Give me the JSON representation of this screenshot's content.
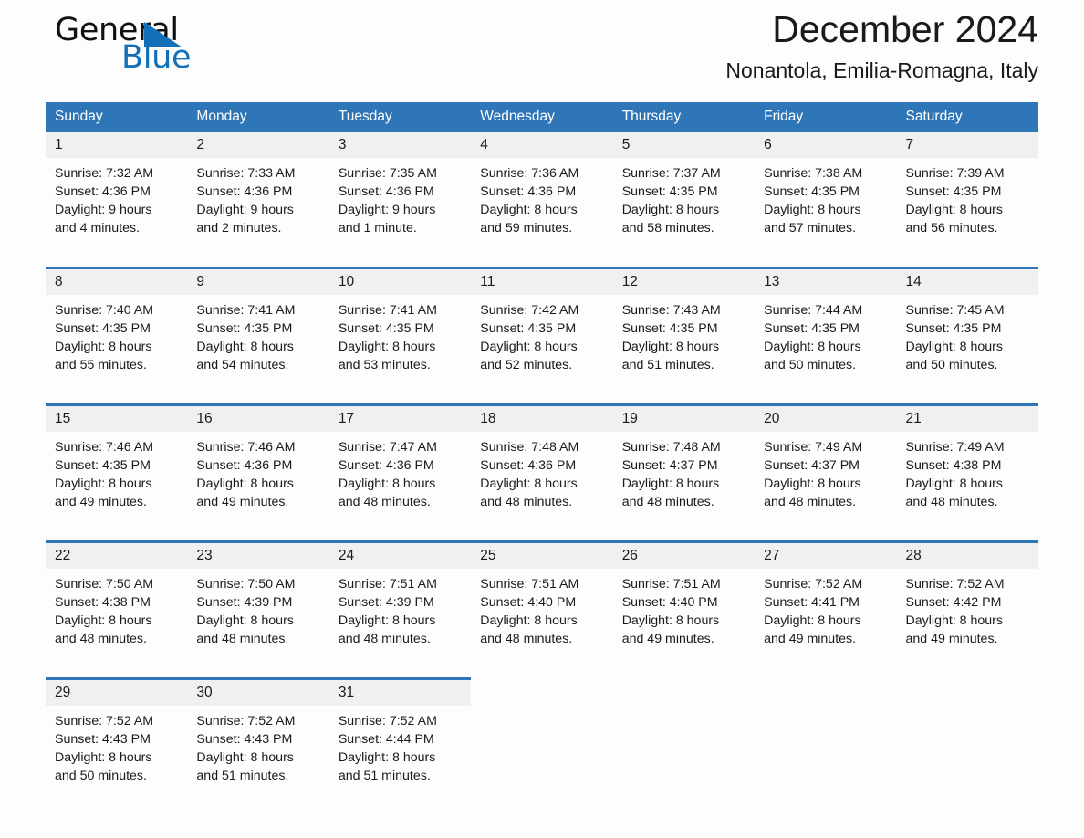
{
  "brand": {
    "word_one": "General",
    "word_two": "Blue",
    "triangle_color": "#1170b8"
  },
  "header": {
    "title": "December 2024",
    "subtitle": "Nonantola, Emilia-Romagna, Italy",
    "header_bg": "#2f76b8",
    "daynum_bg": "#f0f0f0"
  },
  "calendar": {
    "weekday_headers": [
      "Sunday",
      "Monday",
      "Tuesday",
      "Wednesday",
      "Thursday",
      "Friday",
      "Saturday"
    ],
    "weeks": [
      [
        {
          "day": "1",
          "sunrise": "Sunrise: 7:32 AM",
          "sunset": "Sunset: 4:36 PM",
          "daylight_line1": "Daylight: 9 hours",
          "daylight_line2": "and 4 minutes."
        },
        {
          "day": "2",
          "sunrise": "Sunrise: 7:33 AM",
          "sunset": "Sunset: 4:36 PM",
          "daylight_line1": "Daylight: 9 hours",
          "daylight_line2": "and 2 minutes."
        },
        {
          "day": "3",
          "sunrise": "Sunrise: 7:35 AM",
          "sunset": "Sunset: 4:36 PM",
          "daylight_line1": "Daylight: 9 hours",
          "daylight_line2": "and 1 minute."
        },
        {
          "day": "4",
          "sunrise": "Sunrise: 7:36 AM",
          "sunset": "Sunset: 4:36 PM",
          "daylight_line1": "Daylight: 8 hours",
          "daylight_line2": "and 59 minutes."
        },
        {
          "day": "5",
          "sunrise": "Sunrise: 7:37 AM",
          "sunset": "Sunset: 4:35 PM",
          "daylight_line1": "Daylight: 8 hours",
          "daylight_line2": "and 58 minutes."
        },
        {
          "day": "6",
          "sunrise": "Sunrise: 7:38 AM",
          "sunset": "Sunset: 4:35 PM",
          "daylight_line1": "Daylight: 8 hours",
          "daylight_line2": "and 57 minutes."
        },
        {
          "day": "7",
          "sunrise": "Sunrise: 7:39 AM",
          "sunset": "Sunset: 4:35 PM",
          "daylight_line1": "Daylight: 8 hours",
          "daylight_line2": "and 56 minutes."
        }
      ],
      [
        {
          "day": "8",
          "sunrise": "Sunrise: 7:40 AM",
          "sunset": "Sunset: 4:35 PM",
          "daylight_line1": "Daylight: 8 hours",
          "daylight_line2": "and 55 minutes."
        },
        {
          "day": "9",
          "sunrise": "Sunrise: 7:41 AM",
          "sunset": "Sunset: 4:35 PM",
          "daylight_line1": "Daylight: 8 hours",
          "daylight_line2": "and 54 minutes."
        },
        {
          "day": "10",
          "sunrise": "Sunrise: 7:41 AM",
          "sunset": "Sunset: 4:35 PM",
          "daylight_line1": "Daylight: 8 hours",
          "daylight_line2": "and 53 minutes."
        },
        {
          "day": "11",
          "sunrise": "Sunrise: 7:42 AM",
          "sunset": "Sunset: 4:35 PM",
          "daylight_line1": "Daylight: 8 hours",
          "daylight_line2": "and 52 minutes."
        },
        {
          "day": "12",
          "sunrise": "Sunrise: 7:43 AM",
          "sunset": "Sunset: 4:35 PM",
          "daylight_line1": "Daylight: 8 hours",
          "daylight_line2": "and 51 minutes."
        },
        {
          "day": "13",
          "sunrise": "Sunrise: 7:44 AM",
          "sunset": "Sunset: 4:35 PM",
          "daylight_line1": "Daylight: 8 hours",
          "daylight_line2": "and 50 minutes."
        },
        {
          "day": "14",
          "sunrise": "Sunrise: 7:45 AM",
          "sunset": "Sunset: 4:35 PM",
          "daylight_line1": "Daylight: 8 hours",
          "daylight_line2": "and 50 minutes."
        }
      ],
      [
        {
          "day": "15",
          "sunrise": "Sunrise: 7:46 AM",
          "sunset": "Sunset: 4:35 PM",
          "daylight_line1": "Daylight: 8 hours",
          "daylight_line2": "and 49 minutes."
        },
        {
          "day": "16",
          "sunrise": "Sunrise: 7:46 AM",
          "sunset": "Sunset: 4:36 PM",
          "daylight_line1": "Daylight: 8 hours",
          "daylight_line2": "and 49 minutes."
        },
        {
          "day": "17",
          "sunrise": "Sunrise: 7:47 AM",
          "sunset": "Sunset: 4:36 PM",
          "daylight_line1": "Daylight: 8 hours",
          "daylight_line2": "and 48 minutes."
        },
        {
          "day": "18",
          "sunrise": "Sunrise: 7:48 AM",
          "sunset": "Sunset: 4:36 PM",
          "daylight_line1": "Daylight: 8 hours",
          "daylight_line2": "and 48 minutes."
        },
        {
          "day": "19",
          "sunrise": "Sunrise: 7:48 AM",
          "sunset": "Sunset: 4:37 PM",
          "daylight_line1": "Daylight: 8 hours",
          "daylight_line2": "and 48 minutes."
        },
        {
          "day": "20",
          "sunrise": "Sunrise: 7:49 AM",
          "sunset": "Sunset: 4:37 PM",
          "daylight_line1": "Daylight: 8 hours",
          "daylight_line2": "and 48 minutes."
        },
        {
          "day": "21",
          "sunrise": "Sunrise: 7:49 AM",
          "sunset": "Sunset: 4:38 PM",
          "daylight_line1": "Daylight: 8 hours",
          "daylight_line2": "and 48 minutes."
        }
      ],
      [
        {
          "day": "22",
          "sunrise": "Sunrise: 7:50 AM",
          "sunset": "Sunset: 4:38 PM",
          "daylight_line1": "Daylight: 8 hours",
          "daylight_line2": "and 48 minutes."
        },
        {
          "day": "23",
          "sunrise": "Sunrise: 7:50 AM",
          "sunset": "Sunset: 4:39 PM",
          "daylight_line1": "Daylight: 8 hours",
          "daylight_line2": "and 48 minutes."
        },
        {
          "day": "24",
          "sunrise": "Sunrise: 7:51 AM",
          "sunset": "Sunset: 4:39 PM",
          "daylight_line1": "Daylight: 8 hours",
          "daylight_line2": "and 48 minutes."
        },
        {
          "day": "25",
          "sunrise": "Sunrise: 7:51 AM",
          "sunset": "Sunset: 4:40 PM",
          "daylight_line1": "Daylight: 8 hours",
          "daylight_line2": "and 48 minutes."
        },
        {
          "day": "26",
          "sunrise": "Sunrise: 7:51 AM",
          "sunset": "Sunset: 4:40 PM",
          "daylight_line1": "Daylight: 8 hours",
          "daylight_line2": "and 49 minutes."
        },
        {
          "day": "27",
          "sunrise": "Sunrise: 7:52 AM",
          "sunset": "Sunset: 4:41 PM",
          "daylight_line1": "Daylight: 8 hours",
          "daylight_line2": "and 49 minutes."
        },
        {
          "day": "28",
          "sunrise": "Sunrise: 7:52 AM",
          "sunset": "Sunset: 4:42 PM",
          "daylight_line1": "Daylight: 8 hours",
          "daylight_line2": "and 49 minutes."
        }
      ],
      [
        {
          "day": "29",
          "sunrise": "Sunrise: 7:52 AM",
          "sunset": "Sunset: 4:43 PM",
          "daylight_line1": "Daylight: 8 hours",
          "daylight_line2": "and 50 minutes."
        },
        {
          "day": "30",
          "sunrise": "Sunrise: 7:52 AM",
          "sunset": "Sunset: 4:43 PM",
          "daylight_line1": "Daylight: 8 hours",
          "daylight_line2": "and 51 minutes."
        },
        {
          "day": "31",
          "sunrise": "Sunrise: 7:52 AM",
          "sunset": "Sunset: 4:44 PM",
          "daylight_line1": "Daylight: 8 hours",
          "daylight_line2": "and 51 minutes."
        },
        {
          "day": "",
          "sunrise": "",
          "sunset": "",
          "daylight_line1": "",
          "daylight_line2": ""
        },
        {
          "day": "",
          "sunrise": "",
          "sunset": "",
          "daylight_line1": "",
          "daylight_line2": ""
        },
        {
          "day": "",
          "sunrise": "",
          "sunset": "",
          "daylight_line1": "",
          "daylight_line2": ""
        },
        {
          "day": "",
          "sunrise": "",
          "sunset": "",
          "daylight_line1": "",
          "daylight_line2": ""
        }
      ]
    ]
  }
}
